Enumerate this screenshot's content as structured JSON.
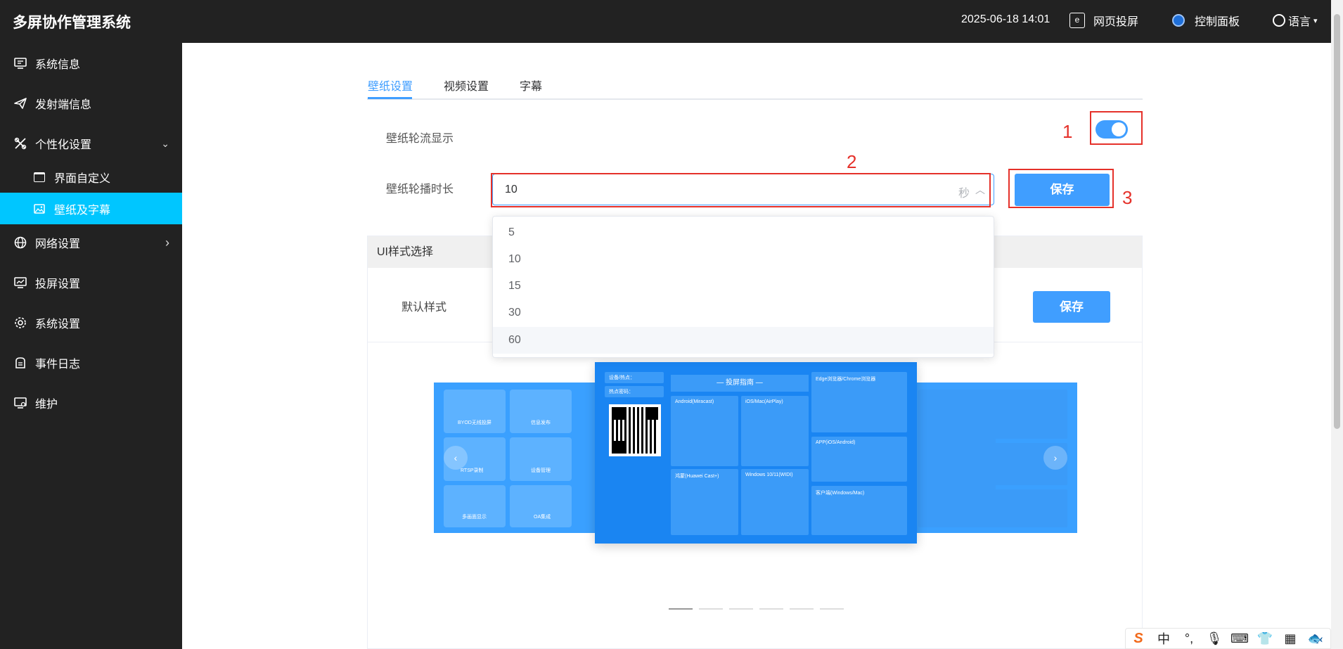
{
  "app": {
    "title": "多屏协作管理系统"
  },
  "header": {
    "datetime": "2025-06-18 14:01",
    "web_cast": "网页投屏",
    "control_panel": "控制面板",
    "language": "语言",
    "web_cast_icon_char": "e"
  },
  "sidebar": {
    "items": [
      {
        "label": "系统信息",
        "icon": "monitor-icon"
      },
      {
        "label": "发射端信息",
        "icon": "send-icon"
      },
      {
        "label": "个性化设置",
        "icon": "tools-icon",
        "expanded": true
      },
      {
        "label": "界面自定义",
        "icon": "window-icon"
      },
      {
        "label": "壁纸及字幕",
        "icon": "image-icon",
        "active": true
      },
      {
        "label": "网络设置",
        "icon": "network-icon"
      },
      {
        "label": "投屏设置",
        "icon": "screen-chart-icon"
      },
      {
        "label": "系统设置",
        "icon": "gear-icon"
      },
      {
        "label": "事件日志",
        "icon": "log-icon"
      },
      {
        "label": "维护",
        "icon": "maintenance-icon"
      }
    ],
    "chevron_down": "⌄",
    "chevron_right": "›"
  },
  "tabs": [
    {
      "label": "壁纸设置",
      "active": true
    },
    {
      "label": "视频设置",
      "active": false
    },
    {
      "label": "字幕",
      "active": false
    }
  ],
  "form": {
    "rotation_label": "壁纸轮流显示",
    "rotation_enabled": true,
    "duration_label": "壁纸轮播时长",
    "duration_value": "10",
    "duration_unit": "秒",
    "duration_options": [
      "5",
      "10",
      "15",
      "30",
      "60"
    ],
    "hovered_option": "60",
    "save_label": "保存"
  },
  "annotations": [
    "1",
    "2",
    "3"
  ],
  "ui_style": {
    "header": "UI样式选择",
    "default_label": "默认样式",
    "save_label": "保存"
  },
  "carousel": {
    "guide_title": "— 投屏指南 —",
    "panels": [
      "Android(Miracast)",
      "iOS/Mac(AirPlay)",
      "Edge浏览器/Chrome浏览器",
      "鸿蒙(Huawei Cast+)",
      "Windows 10/11(WIDI)",
      "APP(iOS/Android)",
      "客户端(Windows/Mac)"
    ],
    "device_line": "设备/热点：",
    "password_line": "热点密码：",
    "tiles": [
      "BYOD无线投屏",
      "信息发布",
      "RTSP录制",
      "设备管理",
      "多画面显示",
      "OA集成"
    ],
    "slide_count": 6,
    "active_slide": 0
  },
  "ime": {
    "logo": "S",
    "mode": "中"
  },
  "colors": {
    "primary": "#409eff",
    "sidebar_bg": "#222222",
    "active_nav": "#00c6ff",
    "annotation": "#e5312a"
  }
}
